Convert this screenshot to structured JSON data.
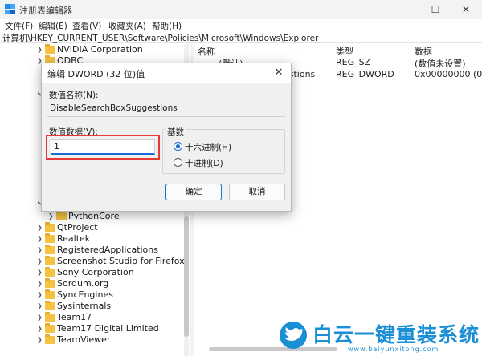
{
  "window": {
    "title": "注册表编辑器",
    "minimize_glyph": "—",
    "maximize_glyph": "☐",
    "close_glyph": "✕"
  },
  "menu": {
    "items": [
      "文件(F)",
      "编辑(E)",
      "查看(V)",
      "收藏夹(A)",
      "帮助(H)"
    ]
  },
  "address": {
    "path": "计算机\\HKEY_CURRENT_USER\\Software\\Policies\\Microsoft\\Windows\\Explorer"
  },
  "tree": {
    "items": [
      {
        "label": "NVIDIA Corporation"
      },
      {
        "label": "ODBC"
      },
      {
        "label": "PythonCore"
      },
      {
        "label": "QtProject"
      },
      {
        "label": "Realtek"
      },
      {
        "label": "RegisteredApplications"
      },
      {
        "label": "Screenshot Studio for Firefox"
      },
      {
        "label": "Sony Corporation"
      },
      {
        "label": "Sordum.org"
      },
      {
        "label": "SyncEngines"
      },
      {
        "label": "Sysinternals"
      },
      {
        "label": "Team17"
      },
      {
        "label": "Team17 Digital Limited"
      },
      {
        "label": "TeamViewer"
      }
    ]
  },
  "values_pane": {
    "headers": {
      "name": "名称",
      "type": "类型",
      "data": "数据"
    },
    "rows": [
      {
        "name": "(默认)",
        "type": "REG_SZ",
        "data": "(数值未设置)"
      },
      {
        "name": "gestions",
        "type": "REG_DWORD",
        "data": "0x00000000 (0)"
      }
    ]
  },
  "dialog": {
    "title": "编辑 DWORD (32 位)值",
    "close_glyph": "✕",
    "name_label": "数值名称(N):",
    "name_value": "DisableSearchBoxSuggestions",
    "data_label": "数值数据(V):",
    "data_value": "1",
    "base_label": "基数",
    "radio_hex": "十六进制(H)",
    "radio_dec": "十进制(D)",
    "selected_base": "hex",
    "ok_label": "确定",
    "cancel_label": "取消"
  },
  "watermark": {
    "title": "白云一键重装系统",
    "url": "www.baiyunxitong.com"
  },
  "colors": {
    "accent": "#1a6dd4",
    "highlight_box": "#e53935",
    "watermark": "#1a8fd6",
    "folder": "#f5c242"
  }
}
